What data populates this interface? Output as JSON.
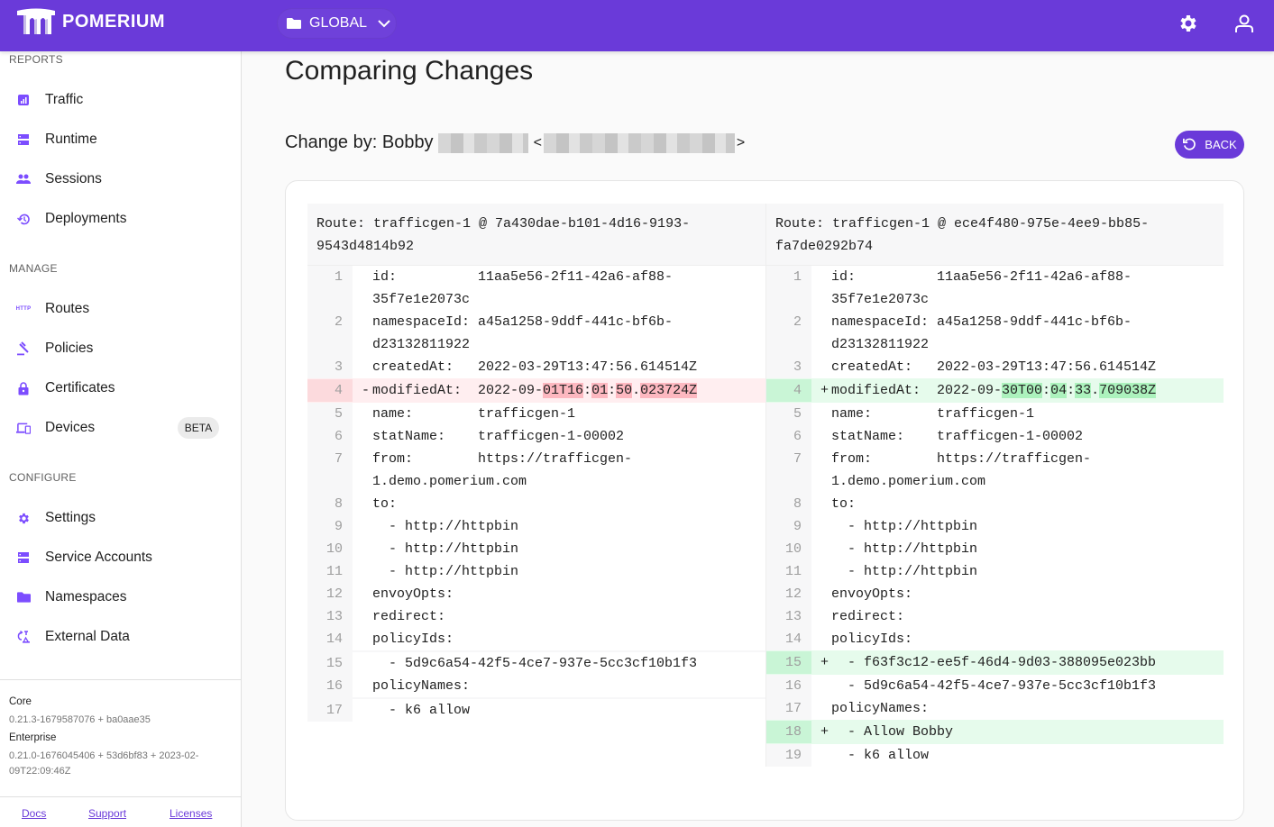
{
  "header": {
    "brand": "POMERIUM",
    "namespace": "GLOBAL",
    "icons": [
      "settings-icon",
      "user-icon"
    ]
  },
  "sidebar": {
    "sections": [
      {
        "label": "REPORTS",
        "items": [
          {
            "label": "Traffic",
            "icon": "bar-chart-icon"
          },
          {
            "label": "Runtime",
            "icon": "server-icon"
          },
          {
            "label": "Sessions",
            "icon": "people-icon"
          },
          {
            "label": "Deployments",
            "icon": "history-icon"
          }
        ]
      },
      {
        "label": "MANAGE",
        "items": [
          {
            "label": "Routes",
            "icon": "http-icon"
          },
          {
            "label": "Policies",
            "icon": "gavel-icon"
          },
          {
            "label": "Certificates",
            "icon": "lock-icon"
          },
          {
            "label": "Devices",
            "icon": "devices-icon",
            "badge": "BETA"
          }
        ]
      },
      {
        "label": "CONFIGURE",
        "items": [
          {
            "label": "Settings",
            "icon": "gear-icon"
          },
          {
            "label": "Service Accounts",
            "icon": "server-icon"
          },
          {
            "label": "Namespaces",
            "icon": "folder-icon"
          },
          {
            "label": "External Data",
            "icon": "sync-data-icon"
          }
        ]
      }
    ],
    "versions": {
      "core_label": "Core",
      "core_value": "0.21.3-1679587076 + ba0aae35",
      "enterprise_label": "Enterprise",
      "enterprise_value": "0.21.0-1676045406 + 53d6bf83 + 2023-02-09T22:09:46Z"
    },
    "footer_links": [
      "Docs",
      "Support",
      "Licenses"
    ]
  },
  "main": {
    "title": "Comparing Changes",
    "change_by_label": "Change by: Bobby",
    "back_label": "BACK",
    "diff": {
      "left_header": "Route: trafficgen-1 @ 7a430dae-b101-4d16-9193-9543d4814b92",
      "right_header": "Route: trafficgen-1 @ ece4f480-975e-4ee9-bb85-fa7de0292b74",
      "left_rows": [
        {
          "n": "1",
          "type": "ctx",
          "lines": [
            "id:          11aa5e56-2f11-42a6-af88-",
            "35f7e1e2073c"
          ]
        },
        {
          "n": "2",
          "type": "ctx",
          "lines": [
            "namespaceId: a45a1258-9ddf-441c-bf6b-",
            "d23132811922"
          ]
        },
        {
          "n": "3",
          "type": "ctx",
          "lines": [
            "createdAt:   2022-03-29T13:47:56.614514Z"
          ]
        },
        {
          "n": "4",
          "type": "del",
          "sign": "-",
          "segments": [
            [
              "modifiedAt:  2022-09-",
              false
            ],
            [
              "01T16",
              true
            ],
            [
              ":",
              false
            ],
            [
              "01",
              true
            ],
            [
              ":",
              false
            ],
            [
              "50",
              true
            ],
            [
              ".",
              false
            ],
            [
              "023724Z",
              true
            ]
          ]
        },
        {
          "n": "5",
          "type": "ctx",
          "lines": [
            "name:        trafficgen-1"
          ]
        },
        {
          "n": "6",
          "type": "ctx",
          "lines": [
            "statName:    trafficgen-1-00002"
          ]
        },
        {
          "n": "7",
          "type": "ctx",
          "lines": [
            "from:        https://trafficgen-",
            "1.demo.pomerium.com"
          ]
        },
        {
          "n": "8",
          "type": "ctx",
          "lines": [
            "to:"
          ]
        },
        {
          "n": "9",
          "type": "ctx",
          "lines": [
            "  - http://httpbin"
          ]
        },
        {
          "n": "10",
          "type": "ctx",
          "lines": [
            "  - http://httpbin"
          ]
        },
        {
          "n": "11",
          "type": "ctx",
          "lines": [
            "  - http://httpbin"
          ]
        },
        {
          "n": "12",
          "type": "ctx",
          "lines": [
            "envoyOpts:"
          ]
        },
        {
          "n": "13",
          "type": "ctx",
          "lines": [
            "redirect:"
          ]
        },
        {
          "n": "14",
          "type": "ctx",
          "lines": [
            "policyIds:"
          ]
        },
        {
          "n": "",
          "type": "empty",
          "lines": [
            ""
          ]
        },
        {
          "n": "15",
          "type": "ctx",
          "lines": [
            "  - 5d9c6a54-42f5-4ce7-937e-5cc3cf10b1f3"
          ]
        },
        {
          "n": "16",
          "type": "ctx",
          "lines": [
            "policyNames:"
          ]
        },
        {
          "n": "",
          "type": "empty",
          "lines": [
            ""
          ]
        },
        {
          "n": "17",
          "type": "ctx",
          "lines": [
            "  - k6 allow"
          ]
        }
      ],
      "right_rows": [
        {
          "n": "1",
          "type": "ctx",
          "lines": [
            "id:          11aa5e56-2f11-42a6-af88-",
            "35f7e1e2073c"
          ]
        },
        {
          "n": "2",
          "type": "ctx",
          "lines": [
            "namespaceId: a45a1258-9ddf-441c-bf6b-",
            "d23132811922"
          ]
        },
        {
          "n": "3",
          "type": "ctx",
          "lines": [
            "createdAt:   2022-03-29T13:47:56.614514Z"
          ]
        },
        {
          "n": "4",
          "type": "add",
          "sign": "+",
          "segments": [
            [
              "modifiedAt:  2022-09-",
              false
            ],
            [
              "30T00",
              true
            ],
            [
              ":",
              false
            ],
            [
              "04",
              true
            ],
            [
              ":",
              false
            ],
            [
              "33",
              true
            ],
            [
              ".",
              false
            ],
            [
              "709038Z",
              true
            ]
          ]
        },
        {
          "n": "5",
          "type": "ctx",
          "lines": [
            "name:        trafficgen-1"
          ]
        },
        {
          "n": "6",
          "type": "ctx",
          "lines": [
            "statName:    trafficgen-1-00002"
          ]
        },
        {
          "n": "7",
          "type": "ctx",
          "lines": [
            "from:        https://trafficgen-",
            "1.demo.pomerium.com"
          ]
        },
        {
          "n": "8",
          "type": "ctx",
          "lines": [
            "to:"
          ]
        },
        {
          "n": "9",
          "type": "ctx",
          "lines": [
            "  - http://httpbin"
          ]
        },
        {
          "n": "10",
          "type": "ctx",
          "lines": [
            "  - http://httpbin"
          ]
        },
        {
          "n": "11",
          "type": "ctx",
          "lines": [
            "  - http://httpbin"
          ]
        },
        {
          "n": "12",
          "type": "ctx",
          "lines": [
            "envoyOpts:"
          ]
        },
        {
          "n": "13",
          "type": "ctx",
          "lines": [
            "redirect:"
          ]
        },
        {
          "n": "14",
          "type": "ctx",
          "lines": [
            "policyIds:"
          ]
        },
        {
          "n": "15",
          "type": "add",
          "sign": "+",
          "lines": [
            "  - f63f3c12-ee5f-46d4-9d03-388095e023bb"
          ]
        },
        {
          "n": "16",
          "type": "ctx",
          "lines": [
            "  - 5d9c6a54-42f5-4ce7-937e-5cc3cf10b1f3"
          ]
        },
        {
          "n": "17",
          "type": "ctx",
          "lines": [
            "policyNames:"
          ]
        },
        {
          "n": "18",
          "type": "add",
          "sign": "+",
          "lines": [
            "  - Allow Bobby"
          ]
        },
        {
          "n": "19",
          "type": "ctx",
          "lines": [
            "  - k6 allow"
          ]
        }
      ]
    }
  },
  "colors": {
    "brand": "#6a3ad9",
    "del_bg": "#ffeef0",
    "del_highlight": "#fdb8c0",
    "add_bg": "#e6fbec",
    "add_highlight": "#acf2bd"
  }
}
